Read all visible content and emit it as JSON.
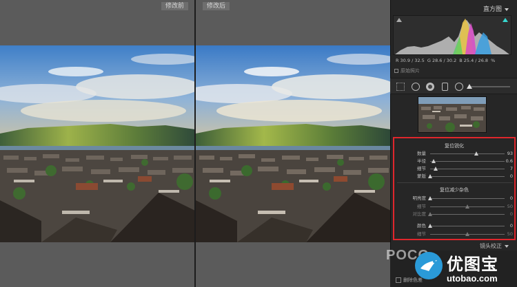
{
  "compare": {
    "before_label": "修改前",
    "after_label": "修改后"
  },
  "histogram": {
    "title": "直方图",
    "readout": {
      "r_label": "R",
      "r_value": "30.9 / 32.5",
      "g_label": "G",
      "g_value": "28.6 / 30.2",
      "b_label": "B",
      "b_value": "25.4 / 26.8",
      "unit": "%"
    },
    "original_photo_label": "原始照片"
  },
  "detail": {
    "sharpen_title": "复位锐化",
    "sliders_sharpen": [
      {
        "label": "数量",
        "value": "93",
        "fraction": 0.62
      },
      {
        "label": "半径",
        "value": "0.6",
        "fraction": 0.05
      },
      {
        "label": "细节",
        "value": "7",
        "fraction": 0.07
      },
      {
        "label": "蒙版",
        "value": "0",
        "fraction": 0.0
      }
    ],
    "noise_title": "复位减少杂色",
    "sliders_noise": [
      {
        "label": "明亮度",
        "value": "0",
        "fraction": 0.0
      },
      {
        "label": "细节",
        "value": "50",
        "fraction": 0.5
      },
      {
        "label": "对比度",
        "value": "0",
        "fraction": 0.0
      },
      {
        "label": "颜色",
        "value": "0",
        "fraction": 0.0
      },
      {
        "label": "细节",
        "value": "50",
        "fraction": 0.5
      }
    ]
  },
  "lens": {
    "title": "镜头校正"
  },
  "bottom": {
    "checkbox_label": "删除色差"
  },
  "watermark": {
    "poco": "POCO",
    "brand_cn": "优图宝",
    "brand_url": "utobao.com"
  },
  "colors": {
    "highlight_border": "#e0262c",
    "panel_bg": "#262626",
    "compare_bg": "#5b5b5b"
  }
}
